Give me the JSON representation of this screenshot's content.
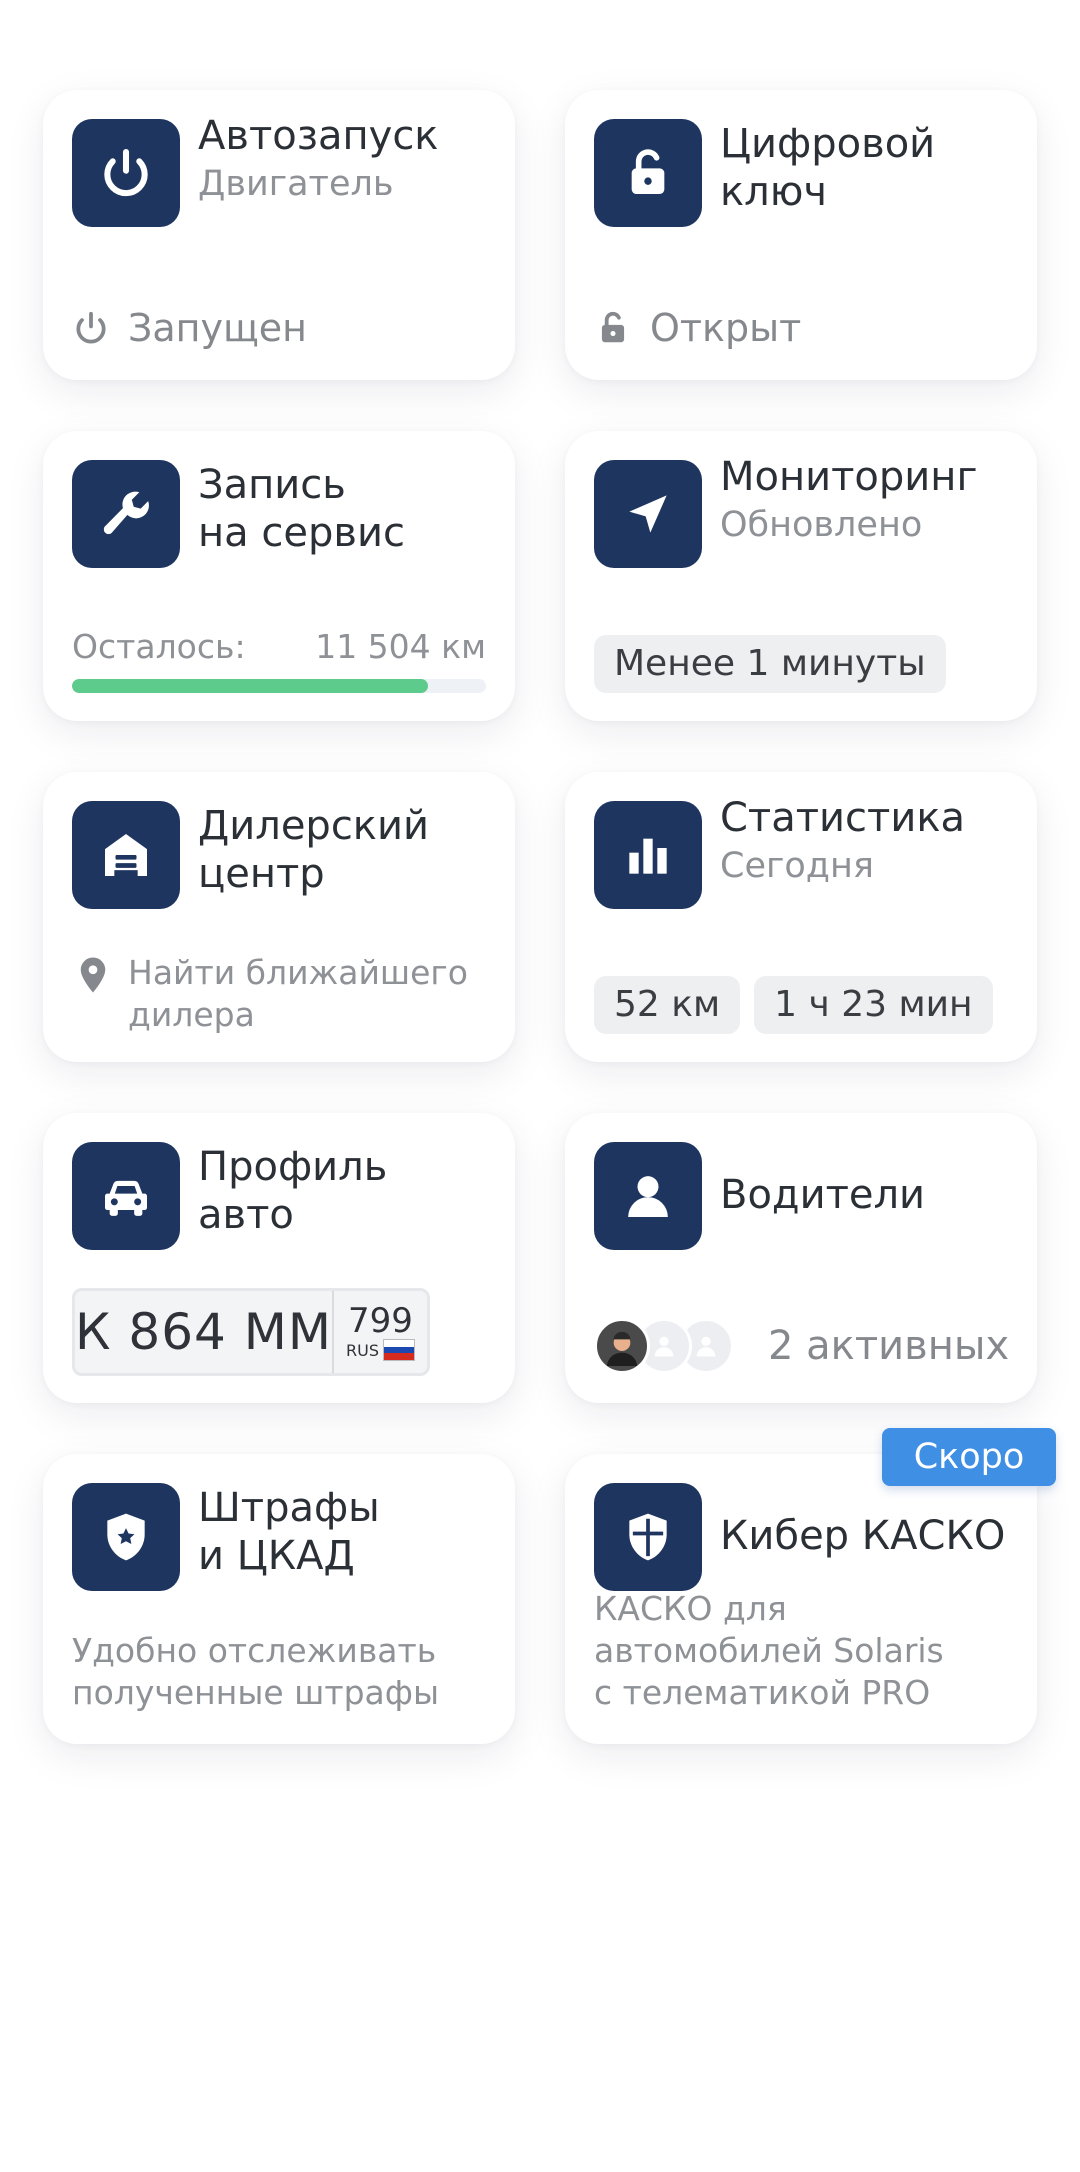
{
  "colors": {
    "icon_bg": "#1e3560",
    "progress": "#5ccb8c",
    "badge": "#3f8fe4"
  },
  "autostart": {
    "title": "Автозапуск",
    "subtitle": "Двигатель",
    "status": "Запущен",
    "icon": "power-icon"
  },
  "digital_key": {
    "title_line1": "Цифровой",
    "title_line2": "ключ",
    "status": "Открыт",
    "icon": "unlock-icon"
  },
  "service": {
    "title_line1": "Запись",
    "title_line2": "на сервис",
    "remaining_label": "Осталось:",
    "remaining_value": "11 504 км",
    "progress": 0.86,
    "icon": "wrench-icon"
  },
  "monitoring": {
    "title": "Мониторинг",
    "subtitle": "Обновлено",
    "chip": "Менее 1 минуты",
    "icon": "navigation-arrow-icon"
  },
  "dealer": {
    "title_line1": "Дилерский",
    "title_line2": "центр",
    "hint_line1": "Найти ближайшего",
    "hint_line2": "дилера",
    "icon": "garage-icon"
  },
  "statistics": {
    "title": "Статистика",
    "subtitle": "Сегодня",
    "chips": [
      "52 км",
      "1 ч 23 мин"
    ],
    "icon": "bar-chart-icon"
  },
  "car_profile": {
    "title_line1": "Профиль",
    "title_line2": "авто",
    "plate_number": "К 864 ММ",
    "plate_region": "799",
    "plate_country": "RUS",
    "icon": "car-icon"
  },
  "drivers": {
    "title": "Водители",
    "active": "2 активных",
    "icon": "person-icon"
  },
  "fines": {
    "title_line1": "Штрафы",
    "title_line2": "и ЦКАД",
    "desc_line1": "Удобно отслеживать",
    "desc_line2": "полученные штрафы",
    "icon": "police-badge-icon"
  },
  "cyber_kasko": {
    "title": "Кибер КАСКО",
    "badge": "Скоро",
    "desc_line1": "КАСКО для",
    "desc_line2": "автомобилей Solaris",
    "desc_line3": "с телематикой PRO",
    "icon": "shield-icon"
  }
}
